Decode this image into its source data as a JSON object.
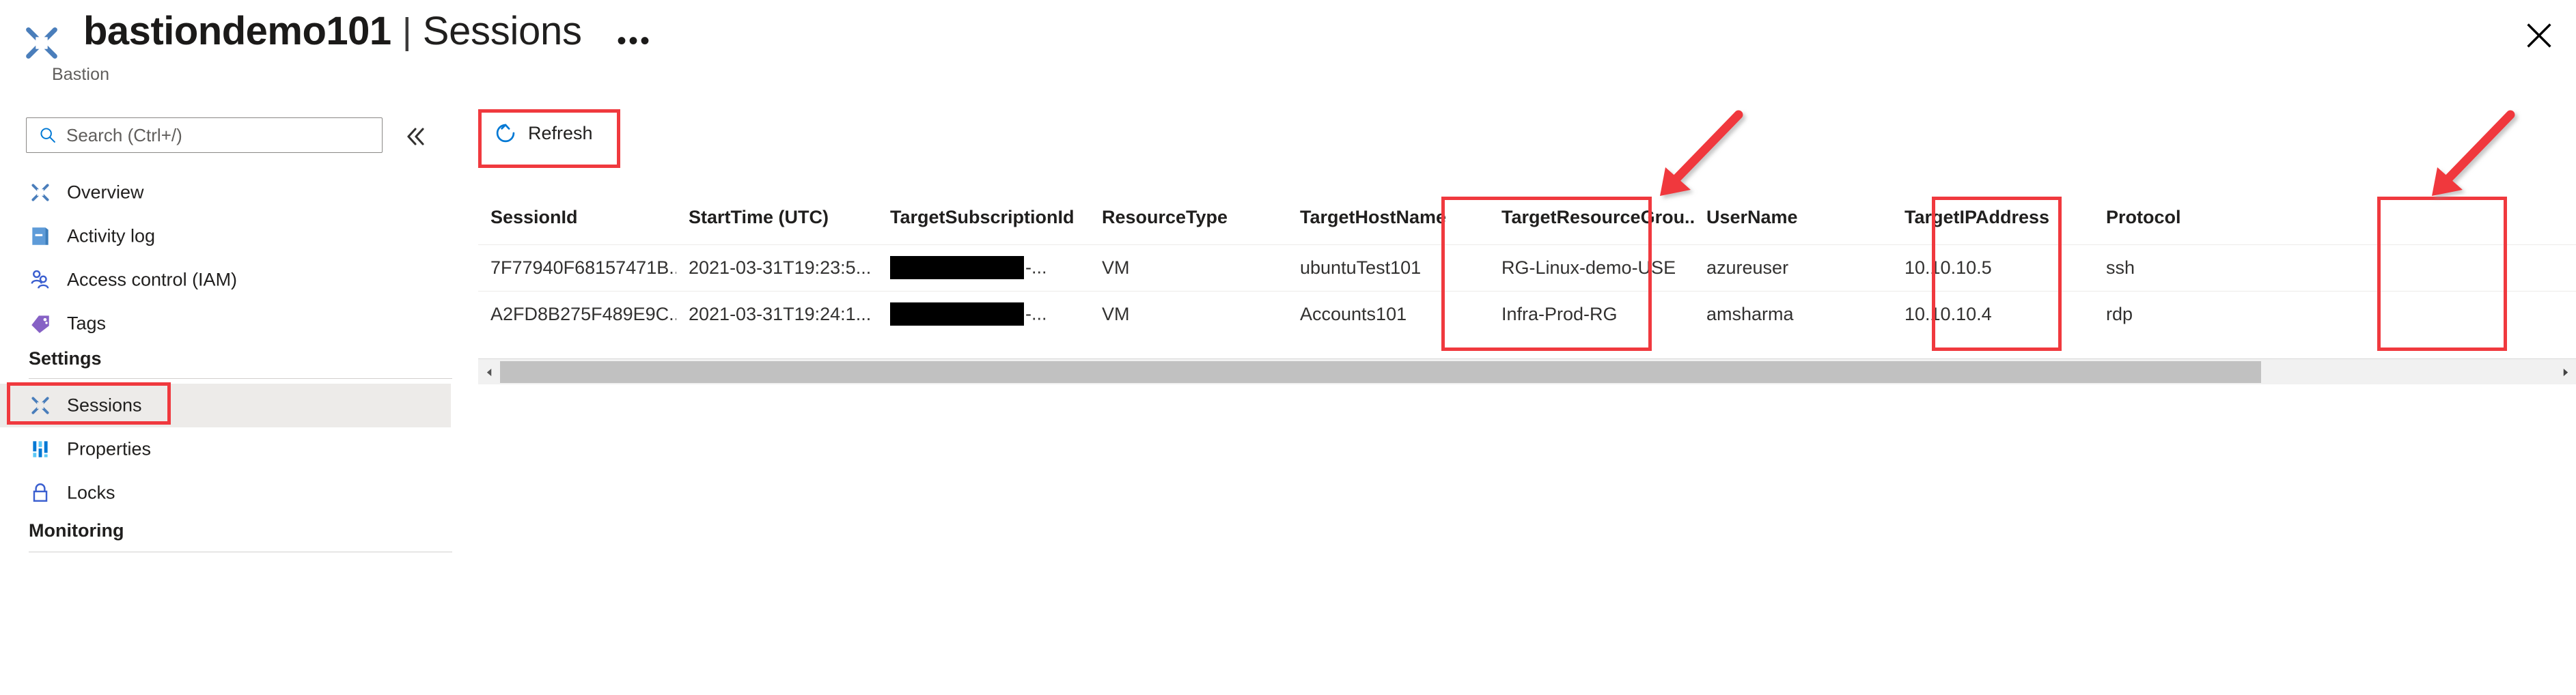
{
  "header": {
    "title": "bastiondemo101",
    "separator": "|",
    "section": "Sessions",
    "subtitle": "Bastion",
    "more_menu": "•••",
    "close_label": "Close",
    "icon": "bastion-icon"
  },
  "sidebar": {
    "search": {
      "placeholder": "Search (Ctrl+/)",
      "value": "",
      "icon": "search-icon"
    },
    "collapse_label": "«",
    "items": [
      {
        "label": "Overview",
        "icon": "bastion-icon",
        "selected": false
      },
      {
        "label": "Activity log",
        "icon": "activity-log-icon",
        "selected": false
      },
      {
        "label": "Access control (IAM)",
        "icon": "access-control-icon",
        "selected": false
      },
      {
        "label": "Tags",
        "icon": "tags-icon",
        "selected": false
      }
    ],
    "groups": [
      {
        "title": "Settings",
        "items": [
          {
            "label": "Sessions",
            "icon": "bastion-icon",
            "selected": true
          },
          {
            "label": "Properties",
            "icon": "properties-icon",
            "selected": false
          },
          {
            "label": "Locks",
            "icon": "lock-icon",
            "selected": false
          }
        ]
      },
      {
        "title": "Monitoring",
        "items": []
      }
    ]
  },
  "toolbar": {
    "refresh_label": "Refresh",
    "refresh_icon": "refresh-icon"
  },
  "table": {
    "columns": [
      "SessionId",
      "StartTime (UTC)",
      "TargetSubscriptionId",
      "ResourceType",
      "TargetHostName",
      "TargetResourceGrou...",
      "UserName",
      "TargetIPAddress",
      "Protocol"
    ],
    "rows": [
      {
        "session_id": "7F77940F68157471B...",
        "start_time": "2021-03-31T19:23:5...",
        "target_subscription_id": "-...",
        "subscription_redacted": true,
        "resource_type": "VM",
        "target_host_name": "ubuntuTest101",
        "target_resource_group": "RG-Linux-demo-USE",
        "user_name": "azureuser",
        "target_ip_address": "10.10.10.5",
        "protocol": "ssh"
      },
      {
        "session_id": "A2FD8B275F489E9C...",
        "start_time": "2021-03-31T19:24:1...",
        "target_subscription_id": "-...",
        "subscription_redacted": true,
        "resource_type": "VM",
        "target_host_name": "Accounts101",
        "target_resource_group": "Infra-Prod-RG",
        "user_name": "amsharma",
        "target_ip_address": "10.10.10.4",
        "protocol": "rdp"
      }
    ]
  },
  "scrollbar": {
    "left_arrow": "◀",
    "right_arrow": "▶"
  },
  "annotations": {
    "highlight_color": "#f0393e",
    "boxes": [
      "refresh-button",
      "sidebar-item-sessions",
      "column-target-host-name",
      "column-user-name",
      "column-protocol"
    ],
    "arrows": [
      "arrow-to-target-host-name",
      "arrow-to-protocol"
    ]
  },
  "colors": {
    "azure_blue": "#0078d4",
    "icon_blue": "#4a7ebb",
    "selected_bg": "#edebe9",
    "text_primary": "#201f1e",
    "text_secondary": "#605e5c"
  }
}
